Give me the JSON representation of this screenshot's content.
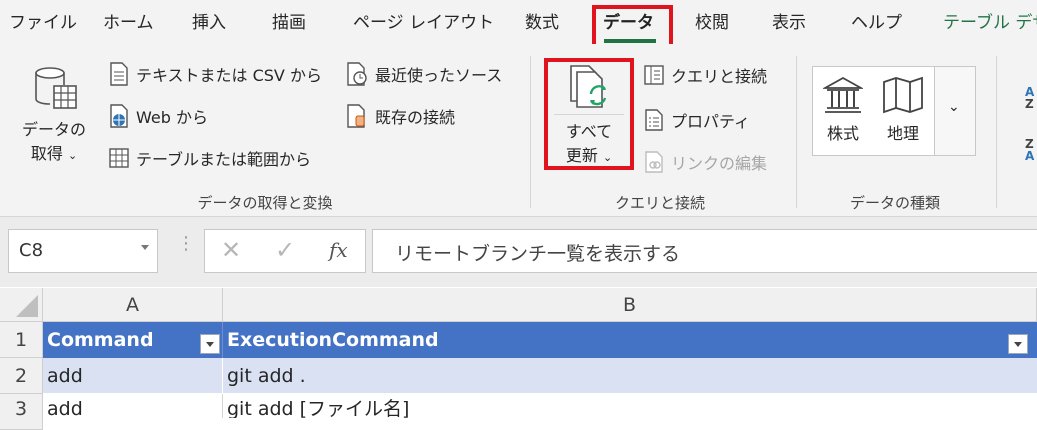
{
  "tabs": [
    "ファイル",
    "ホーム",
    "挿入",
    "描画",
    "ページ レイアウト",
    "数式",
    "データ",
    "校閲",
    "表示",
    "ヘルプ",
    "テーブル デザ"
  ],
  "active_tab": "データ",
  "ribbon": {
    "get_data": {
      "line1": "データの",
      "line2": "取得"
    },
    "from_text_csv": "テキストまたは CSV から",
    "from_web": "Web から",
    "from_table": "テーブルまたは範囲から",
    "recent_sources": "最近使ったソース",
    "existing_connections": "既存の接続",
    "group_get_transform": "データの取得と変換",
    "refresh_all": {
      "line1": "すべて",
      "line2": "更新"
    },
    "queries_connections": "クエリと接続",
    "properties": "プロパティ",
    "edit_links": "リンクの編集",
    "group_queries": "クエリと接続",
    "stocks": "株式",
    "geography": "地理",
    "group_data_types": "データの種類",
    "sort_az_top": "A",
    "sort_az_bottom": "Z",
    "sort_za_top": "Z",
    "sort_za_bottom": "A"
  },
  "formula_bar": {
    "name_box": "C8",
    "fx": "fx",
    "content": "リモートブランチ一覧を表示する"
  },
  "grid": {
    "columns": [
      "A",
      "B"
    ],
    "rows": [
      "1",
      "2",
      "3"
    ],
    "header": [
      "Command",
      "ExecutionCommand"
    ],
    "data": [
      [
        "add",
        "git add ."
      ],
      [
        "add",
        "git add [ファイル名]"
      ]
    ]
  },
  "colors": {
    "accent_green": "#217346",
    "highlight_red": "#e0141e",
    "table_header": "#4472c4",
    "table_band": "#d9e1f2"
  }
}
